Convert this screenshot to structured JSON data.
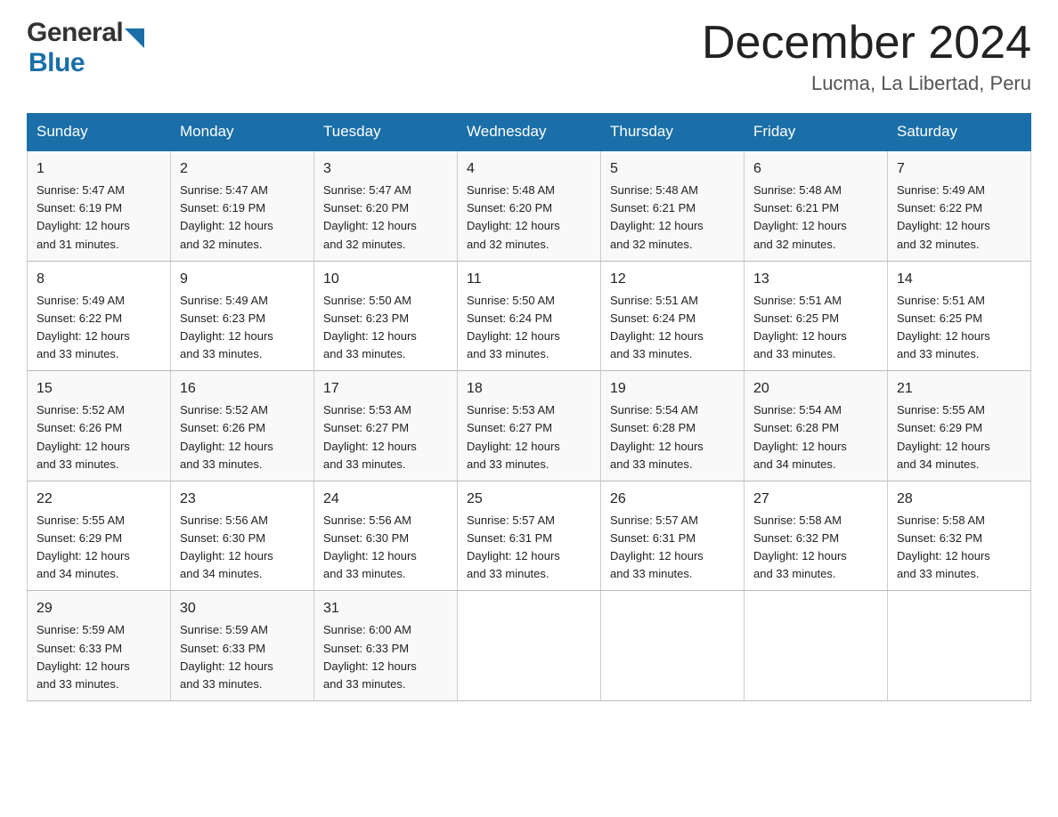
{
  "header": {
    "logo_general": "General",
    "logo_blue": "Blue",
    "month_title": "December 2024",
    "location": "Lucma, La Libertad, Peru"
  },
  "days_of_week": [
    "Sunday",
    "Monday",
    "Tuesday",
    "Wednesday",
    "Thursday",
    "Friday",
    "Saturday"
  ],
  "weeks": [
    [
      {
        "day": "1",
        "sunrise": "5:47 AM",
        "sunset": "6:19 PM",
        "daylight": "12 hours and 31 minutes."
      },
      {
        "day": "2",
        "sunrise": "5:47 AM",
        "sunset": "6:19 PM",
        "daylight": "12 hours and 32 minutes."
      },
      {
        "day": "3",
        "sunrise": "5:47 AM",
        "sunset": "6:20 PM",
        "daylight": "12 hours and 32 minutes."
      },
      {
        "day": "4",
        "sunrise": "5:48 AM",
        "sunset": "6:20 PM",
        "daylight": "12 hours and 32 minutes."
      },
      {
        "day": "5",
        "sunrise": "5:48 AM",
        "sunset": "6:21 PM",
        "daylight": "12 hours and 32 minutes."
      },
      {
        "day": "6",
        "sunrise": "5:48 AM",
        "sunset": "6:21 PM",
        "daylight": "12 hours and 32 minutes."
      },
      {
        "day": "7",
        "sunrise": "5:49 AM",
        "sunset": "6:22 PM",
        "daylight": "12 hours and 32 minutes."
      }
    ],
    [
      {
        "day": "8",
        "sunrise": "5:49 AM",
        "sunset": "6:22 PM",
        "daylight": "12 hours and 33 minutes."
      },
      {
        "day": "9",
        "sunrise": "5:49 AM",
        "sunset": "6:23 PM",
        "daylight": "12 hours and 33 minutes."
      },
      {
        "day": "10",
        "sunrise": "5:50 AM",
        "sunset": "6:23 PM",
        "daylight": "12 hours and 33 minutes."
      },
      {
        "day": "11",
        "sunrise": "5:50 AM",
        "sunset": "6:24 PM",
        "daylight": "12 hours and 33 minutes."
      },
      {
        "day": "12",
        "sunrise": "5:51 AM",
        "sunset": "6:24 PM",
        "daylight": "12 hours and 33 minutes."
      },
      {
        "day": "13",
        "sunrise": "5:51 AM",
        "sunset": "6:25 PM",
        "daylight": "12 hours and 33 minutes."
      },
      {
        "day": "14",
        "sunrise": "5:51 AM",
        "sunset": "6:25 PM",
        "daylight": "12 hours and 33 minutes."
      }
    ],
    [
      {
        "day": "15",
        "sunrise": "5:52 AM",
        "sunset": "6:26 PM",
        "daylight": "12 hours and 33 minutes."
      },
      {
        "day": "16",
        "sunrise": "5:52 AM",
        "sunset": "6:26 PM",
        "daylight": "12 hours and 33 minutes."
      },
      {
        "day": "17",
        "sunrise": "5:53 AM",
        "sunset": "6:27 PM",
        "daylight": "12 hours and 33 minutes."
      },
      {
        "day": "18",
        "sunrise": "5:53 AM",
        "sunset": "6:27 PM",
        "daylight": "12 hours and 33 minutes."
      },
      {
        "day": "19",
        "sunrise": "5:54 AM",
        "sunset": "6:28 PM",
        "daylight": "12 hours and 33 minutes."
      },
      {
        "day": "20",
        "sunrise": "5:54 AM",
        "sunset": "6:28 PM",
        "daylight": "12 hours and 34 minutes."
      },
      {
        "day": "21",
        "sunrise": "5:55 AM",
        "sunset": "6:29 PM",
        "daylight": "12 hours and 34 minutes."
      }
    ],
    [
      {
        "day": "22",
        "sunrise": "5:55 AM",
        "sunset": "6:29 PM",
        "daylight": "12 hours and 34 minutes."
      },
      {
        "day": "23",
        "sunrise": "5:56 AM",
        "sunset": "6:30 PM",
        "daylight": "12 hours and 34 minutes."
      },
      {
        "day": "24",
        "sunrise": "5:56 AM",
        "sunset": "6:30 PM",
        "daylight": "12 hours and 33 minutes."
      },
      {
        "day": "25",
        "sunrise": "5:57 AM",
        "sunset": "6:31 PM",
        "daylight": "12 hours and 33 minutes."
      },
      {
        "day": "26",
        "sunrise": "5:57 AM",
        "sunset": "6:31 PM",
        "daylight": "12 hours and 33 minutes."
      },
      {
        "day": "27",
        "sunrise": "5:58 AM",
        "sunset": "6:32 PM",
        "daylight": "12 hours and 33 minutes."
      },
      {
        "day": "28",
        "sunrise": "5:58 AM",
        "sunset": "6:32 PM",
        "daylight": "12 hours and 33 minutes."
      }
    ],
    [
      {
        "day": "29",
        "sunrise": "5:59 AM",
        "sunset": "6:33 PM",
        "daylight": "12 hours and 33 minutes."
      },
      {
        "day": "30",
        "sunrise": "5:59 AM",
        "sunset": "6:33 PM",
        "daylight": "12 hours and 33 minutes."
      },
      {
        "day": "31",
        "sunrise": "6:00 AM",
        "sunset": "6:33 PM",
        "daylight": "12 hours and 33 minutes."
      },
      null,
      null,
      null,
      null
    ]
  ],
  "labels": {
    "sunrise": "Sunrise:",
    "sunset": "Sunset:",
    "daylight": "Daylight: 12 hours"
  }
}
